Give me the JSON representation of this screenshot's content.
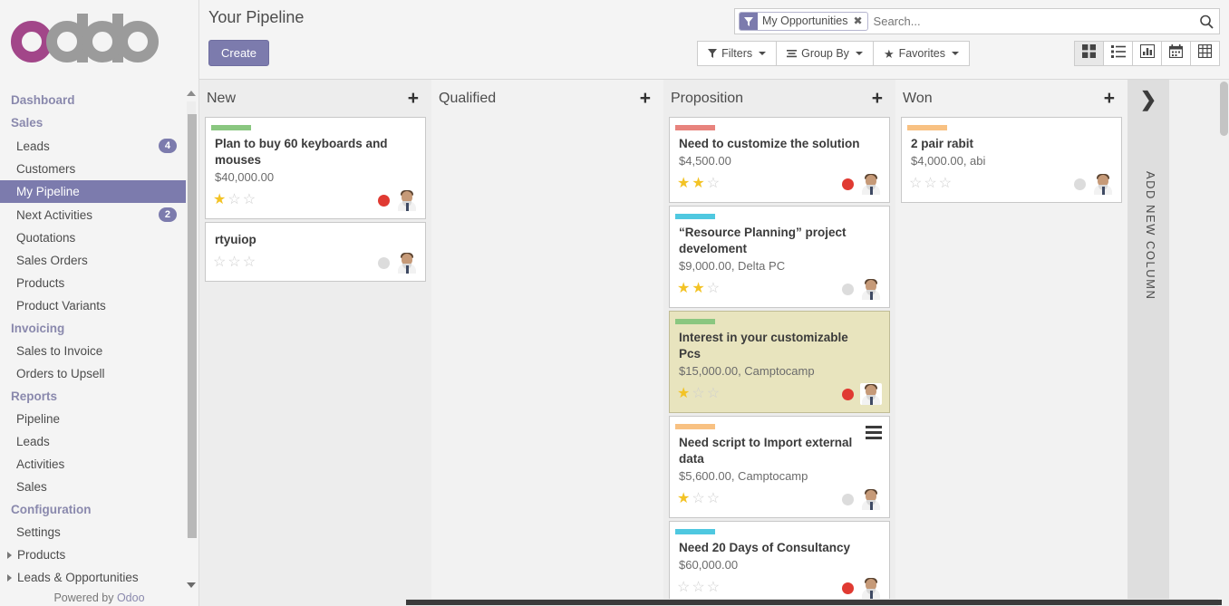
{
  "brand": {
    "name": "odoo",
    "accent": "#a24689",
    "gray": "#9b9b9b",
    "primary": "#7c7bad"
  },
  "sidebar": {
    "sections": [
      {
        "label": "Dashboard",
        "type": "section"
      },
      {
        "label": "Sales",
        "type": "section"
      },
      {
        "label": "Leads",
        "type": "item",
        "badge": "4"
      },
      {
        "label": "Customers",
        "type": "item"
      },
      {
        "label": "My Pipeline",
        "type": "item",
        "active": true
      },
      {
        "label": "Next Activities",
        "type": "item",
        "badge": "2"
      },
      {
        "label": "Quotations",
        "type": "item"
      },
      {
        "label": "Sales Orders",
        "type": "item"
      },
      {
        "label": "Products",
        "type": "item"
      },
      {
        "label": "Product Variants",
        "type": "item"
      },
      {
        "label": "Invoicing",
        "type": "section"
      },
      {
        "label": "Sales to Invoice",
        "type": "item"
      },
      {
        "label": "Orders to Upsell",
        "type": "item"
      },
      {
        "label": "Reports",
        "type": "section"
      },
      {
        "label": "Pipeline",
        "type": "item"
      },
      {
        "label": "Leads",
        "type": "item"
      },
      {
        "label": "Activities",
        "type": "item"
      },
      {
        "label": "Sales",
        "type": "item"
      },
      {
        "label": "Configuration",
        "type": "section"
      },
      {
        "label": "Settings",
        "type": "item"
      },
      {
        "label": "Products",
        "type": "item",
        "caret": true
      },
      {
        "label": "Leads & Opportunities",
        "type": "item",
        "caret": true
      }
    ],
    "footer_prefix": "Powered by ",
    "footer_brand": "Odoo"
  },
  "control_panel": {
    "title": "Your Pipeline",
    "create_label": "Create",
    "search": {
      "facet_label": "My Opportunities",
      "facet_remove": "✖",
      "placeholder": "Search..."
    },
    "filters_label": "Filters",
    "groupby_label": "Group By",
    "favorites_label": "Favorites",
    "views": [
      {
        "name": "kanban-view",
        "icon": "grid-icon",
        "active": true
      },
      {
        "name": "list-view",
        "icon": "list-icon",
        "active": false
      },
      {
        "name": "graph-view",
        "icon": "bar-chart-icon",
        "active": false
      },
      {
        "name": "calendar-view",
        "icon": "calendar-icon",
        "active": false
      },
      {
        "name": "pivot-view",
        "icon": "table-icon",
        "active": false
      }
    ]
  },
  "kanban": {
    "add_column_label": "ADD NEW COLUMN",
    "columns": [
      {
        "title": "New",
        "cards": [
          {
            "name": "Plan to buy 60 keyboards and mouses",
            "meta": "$40,000.00",
            "bar_color": "#8ac780",
            "stars": 1,
            "status": "red",
            "highlighted": false,
            "menu": false
          },
          {
            "name": "rtyuiop",
            "meta": "",
            "bar_color": "",
            "stars": 0,
            "status": "gray",
            "highlighted": false,
            "menu": false
          }
        ]
      },
      {
        "title": "Qualified",
        "cards": []
      },
      {
        "title": "Proposition",
        "cards": [
          {
            "name": "Need to customize the solution",
            "meta": "$4,500.00",
            "bar_color": "#e8837d",
            "stars": 2,
            "status": "red",
            "highlighted": false,
            "menu": false
          },
          {
            "name": "“Resource Planning” project develoment",
            "meta": "$9,000.00, Delta PC",
            "bar_color": "#4fc8e0",
            "stars": 2,
            "status": "gray",
            "highlighted": false,
            "menu": false
          },
          {
            "name": "Interest in your customizable Pcs",
            "meta": "$15,000.00, Camptocamp",
            "bar_color": "#8ac780",
            "stars": 1,
            "status": "red",
            "highlighted": true,
            "menu": false
          },
          {
            "name": "Need script to Import external data",
            "meta": "$5,600.00, Camptocamp",
            "bar_color": "#f8c182",
            "stars": 1,
            "status": "gray",
            "highlighted": false,
            "menu": true
          },
          {
            "name": "Need 20 Days of Consultancy",
            "meta": "$60,000.00",
            "bar_color": "#4fc8e0",
            "stars": 0,
            "status": "red",
            "highlighted": false,
            "menu": false
          }
        ]
      },
      {
        "title": "Won",
        "cards": [
          {
            "name": "2 pair rabit",
            "meta": "$4,000.00, abi",
            "bar_color": "#f8c182",
            "stars": 0,
            "status": "gray",
            "highlighted": false,
            "menu": false
          }
        ]
      }
    ]
  }
}
